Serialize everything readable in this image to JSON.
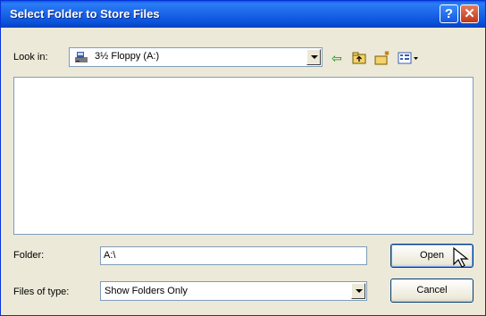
{
  "window": {
    "title": "Select Folder to Store Files",
    "help_glyph": "?",
    "close_glyph": "✕"
  },
  "toolbar": {
    "look_in_label": "Look in:",
    "look_in_value": "3½ Floppy (A:)",
    "look_in_icon": "floppy-drive-icon",
    "back_icon": "back-arrow-icon",
    "up_icon": "up-folder-icon",
    "new_folder_icon": "new-folder-icon",
    "views_icon": "views-menu-icon"
  },
  "folder": {
    "label": "Folder:",
    "value": "A:\\"
  },
  "files_of_type": {
    "label": "Files of type:",
    "value": "Show Folders Only"
  },
  "buttons": {
    "open": "Open",
    "cancel": "Cancel"
  },
  "colors": {
    "title_bar": "#0a5bdf",
    "dialog_bg": "#ece9d8",
    "input_border": "#7f9db9"
  }
}
